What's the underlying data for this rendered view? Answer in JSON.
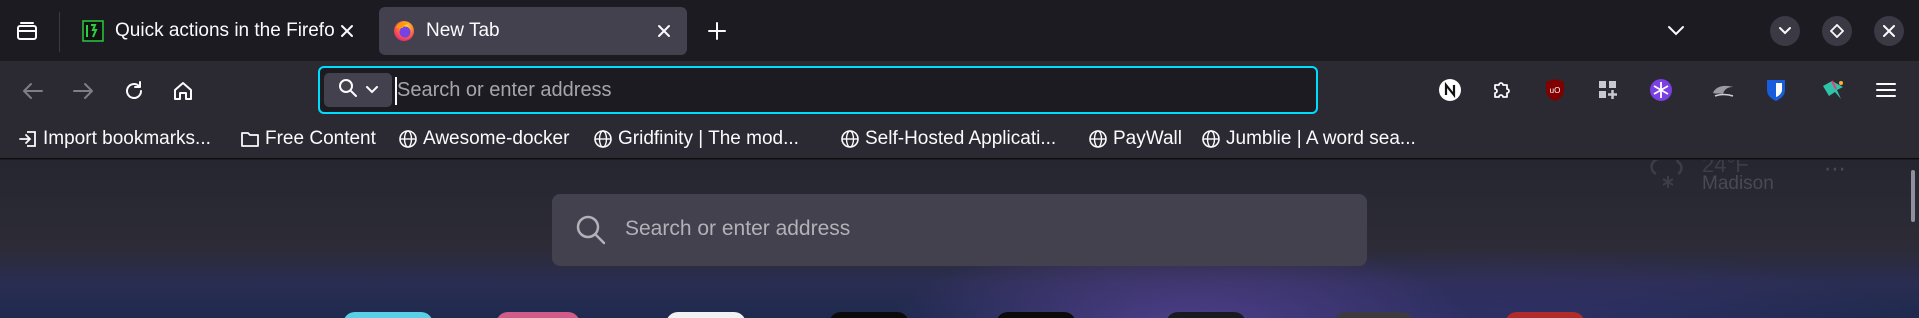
{
  "tabs": [
    {
      "title": "Quick actions in the Firefox",
      "active": false
    },
    {
      "title": "New Tab",
      "active": true
    }
  ],
  "icons": {
    "tab_list": "tab-list-icon",
    "new_tab": "plus-icon",
    "list_all_tabs": "chevron-down-icon",
    "back": "back-arrow-icon",
    "forward": "forward-arrow-icon",
    "reload": "reload-icon",
    "home": "home-icon",
    "menu": "hamburger-menu-icon"
  },
  "urlbar": {
    "placeholder": "Search or enter address",
    "value": ""
  },
  "extensions": [
    "notion-web-clipper",
    "extensions-puzzle",
    "ublock-origin",
    "toolbox",
    "snowflake",
    "cloud-bird",
    "bitwarden",
    "colorful-extension"
  ],
  "bookmarks": [
    {
      "label": "Import bookmarks...",
      "icon": "import-icon"
    },
    {
      "label": "Free Content",
      "icon": "folder-icon"
    },
    {
      "label": "Awesome-docker",
      "icon": "globe-icon"
    },
    {
      "label": "Gridfinity | The mod...",
      "icon": "globe-icon"
    },
    {
      "label": "Self-Hosted Applicati...",
      "icon": "globe-icon"
    },
    {
      "label": "PayWall",
      "icon": "globe-icon"
    },
    {
      "label": "Jumblie | A word sea...",
      "icon": "globe-icon"
    }
  ],
  "newtab": {
    "search_placeholder": "Search or enter address",
    "weather": {
      "temperature": "24°F",
      "location": "Madison",
      "more": "⋯"
    }
  },
  "colors": {
    "accent_focus": "#00ddff",
    "toolbar": "#2b2a33",
    "tabstrip": "#1c1b22",
    "active_tab": "#42414d"
  }
}
